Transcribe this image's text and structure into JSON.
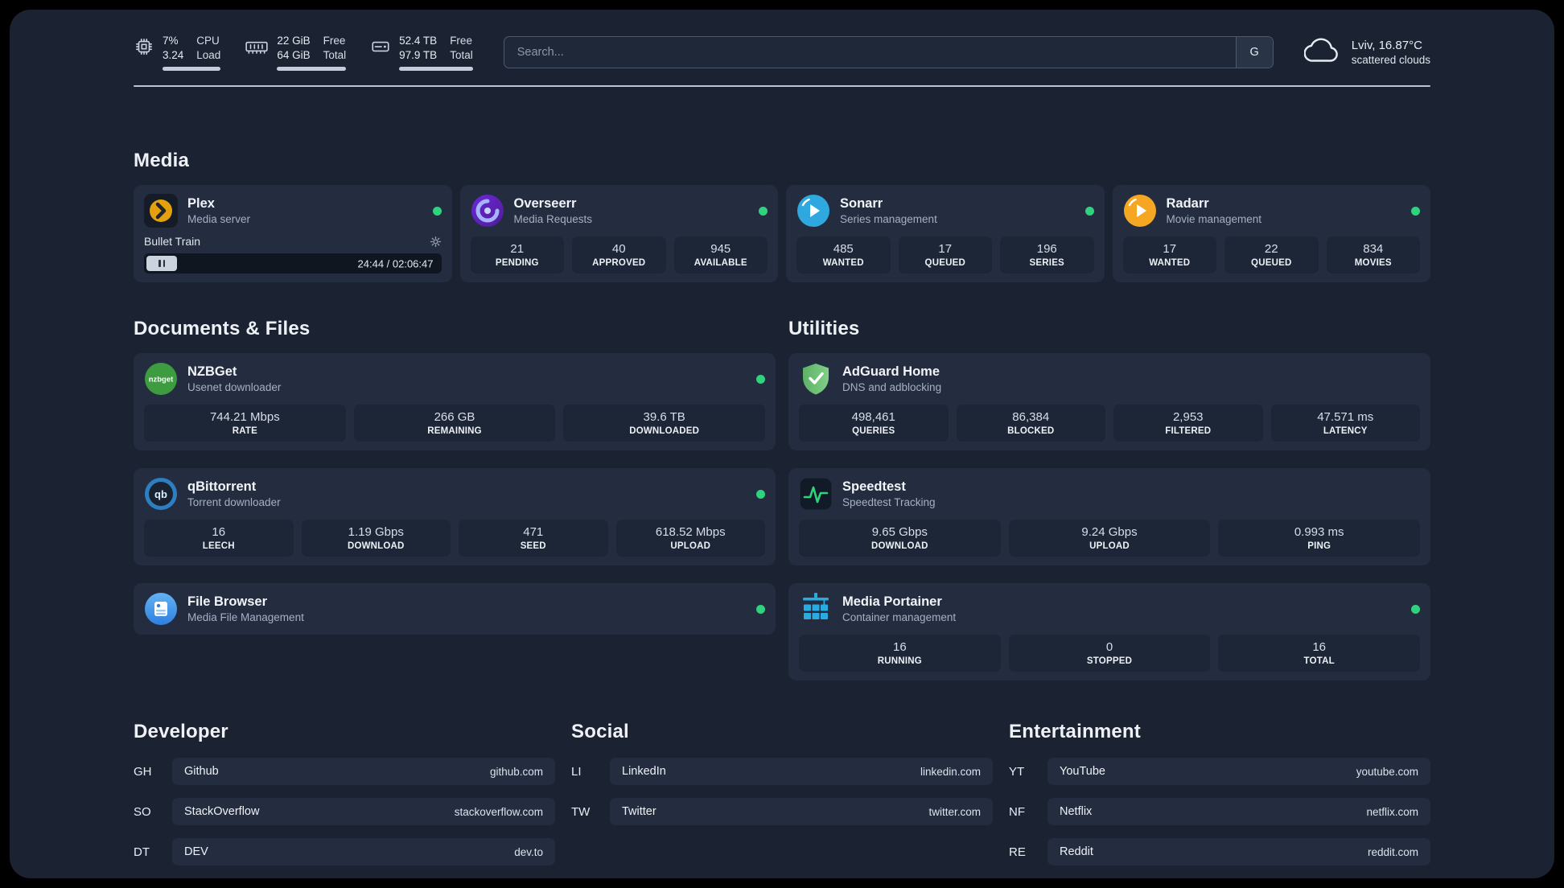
{
  "colors": {
    "green": "#2fd27d",
    "plex": "#e5a00d",
    "sonarr": "#2fa8e0",
    "radarr": "#f5a623",
    "nzbget": "#3d9c40",
    "qbittorrent": "#2e7fc2",
    "filebrowser": "#2f7fe0",
    "adguard": "#68bc71",
    "speedtest": "#2fd27d",
    "portainer": "#29abe2"
  },
  "topbar": {
    "resources": [
      {
        "icon": "cpu-icon",
        "value_top": "7%",
        "value_bottom": "3.24",
        "label_top": "CPU",
        "label_bottom": "Load"
      },
      {
        "icon": "memory-icon",
        "value_top": "22 GiB",
        "value_bottom": "64 GiB",
        "label_top": "Free",
        "label_bottom": "Total"
      },
      {
        "icon": "disk-icon",
        "value_top": "52.4 TB",
        "value_bottom": "97.9 TB",
        "label_top": "Free",
        "label_bottom": "Total"
      }
    ],
    "search": {
      "placeholder": "Search...",
      "provider_label": "G"
    },
    "weather": {
      "location": "Lviv, 16.87°C",
      "condition": "scattered clouds"
    }
  },
  "media": {
    "title": "Media",
    "plex": {
      "name": "Plex",
      "subtitle": "Media server",
      "now_playing": "Bullet Train",
      "time": "24:44 / 02:06:47"
    },
    "overseerr": {
      "name": "Overseerr",
      "subtitle": "Media Requests",
      "stats": [
        {
          "value": "21",
          "label": "PENDING"
        },
        {
          "value": "40",
          "label": "APPROVED"
        },
        {
          "value": "945",
          "label": "AVAILABLE"
        }
      ]
    },
    "sonarr": {
      "name": "Sonarr",
      "subtitle": "Series management",
      "stats": [
        {
          "value": "485",
          "label": "WANTED"
        },
        {
          "value": "17",
          "label": "QUEUED"
        },
        {
          "value": "196",
          "label": "SERIES"
        }
      ]
    },
    "radarr": {
      "name": "Radarr",
      "subtitle": "Movie management",
      "stats": [
        {
          "value": "17",
          "label": "WANTED"
        },
        {
          "value": "22",
          "label": "QUEUED"
        },
        {
          "value": "834",
          "label": "MOVIES"
        }
      ]
    }
  },
  "documents": {
    "title": "Documents & Files",
    "nzbget": {
      "name": "NZBGet",
      "subtitle": "Usenet downloader",
      "stats": [
        {
          "value": "744.21 Mbps",
          "label": "RATE"
        },
        {
          "value": "266 GB",
          "label": "REMAINING"
        },
        {
          "value": "39.6 TB",
          "label": "DOWNLOADED"
        }
      ]
    },
    "qbittorrent": {
      "name": "qBittorrent",
      "subtitle": "Torrent downloader",
      "stats": [
        {
          "value": "16",
          "label": "LEECH"
        },
        {
          "value": "1.19 Gbps",
          "label": "DOWNLOAD"
        },
        {
          "value": "471",
          "label": "SEED"
        },
        {
          "value": "618.52 Mbps",
          "label": "UPLOAD"
        }
      ]
    },
    "filebrowser": {
      "name": "File Browser",
      "subtitle": "Media File Management"
    }
  },
  "utilities": {
    "title": "Utilities",
    "adguard": {
      "name": "AdGuard Home",
      "subtitle": "DNS and adblocking",
      "stats": [
        {
          "value": "498,461",
          "label": "QUERIES"
        },
        {
          "value": "86,384",
          "label": "BLOCKED"
        },
        {
          "value": "2,953",
          "label": "FILTERED"
        },
        {
          "value": "47.571 ms",
          "label": "LATENCY"
        }
      ]
    },
    "speedtest": {
      "name": "Speedtest",
      "subtitle": "Speedtest Tracking",
      "stats": [
        {
          "value": "9.65 Gbps",
          "label": "DOWNLOAD"
        },
        {
          "value": "9.24 Gbps",
          "label": "UPLOAD"
        },
        {
          "value": "0.993 ms",
          "label": "PING"
        }
      ]
    },
    "portainer": {
      "name": "Media Portainer",
      "subtitle": "Container management",
      "stats": [
        {
          "value": "16",
          "label": "RUNNING"
        },
        {
          "value": "0",
          "label": "STOPPED"
        },
        {
          "value": "16",
          "label": "TOTAL"
        }
      ]
    }
  },
  "bookmarks": [
    {
      "title": "Developer",
      "links": [
        {
          "abbr": "GH",
          "label": "Github",
          "domain": "github.com"
        },
        {
          "abbr": "SO",
          "label": "StackOverflow",
          "domain": "stackoverflow.com"
        },
        {
          "abbr": "DT",
          "label": "DEV",
          "domain": "dev.to"
        }
      ]
    },
    {
      "title": "Social",
      "links": [
        {
          "abbr": "LI",
          "label": "LinkedIn",
          "domain": "linkedin.com"
        },
        {
          "abbr": "TW",
          "label": "Twitter",
          "domain": "twitter.com"
        }
      ]
    },
    {
      "title": "Entertainment",
      "links": [
        {
          "abbr": "YT",
          "label": "YouTube",
          "domain": "youtube.com"
        },
        {
          "abbr": "NF",
          "label": "Netflix",
          "domain": "netflix.com"
        },
        {
          "abbr": "RE",
          "label": "Reddit",
          "domain": "reddit.com"
        }
      ]
    }
  ]
}
